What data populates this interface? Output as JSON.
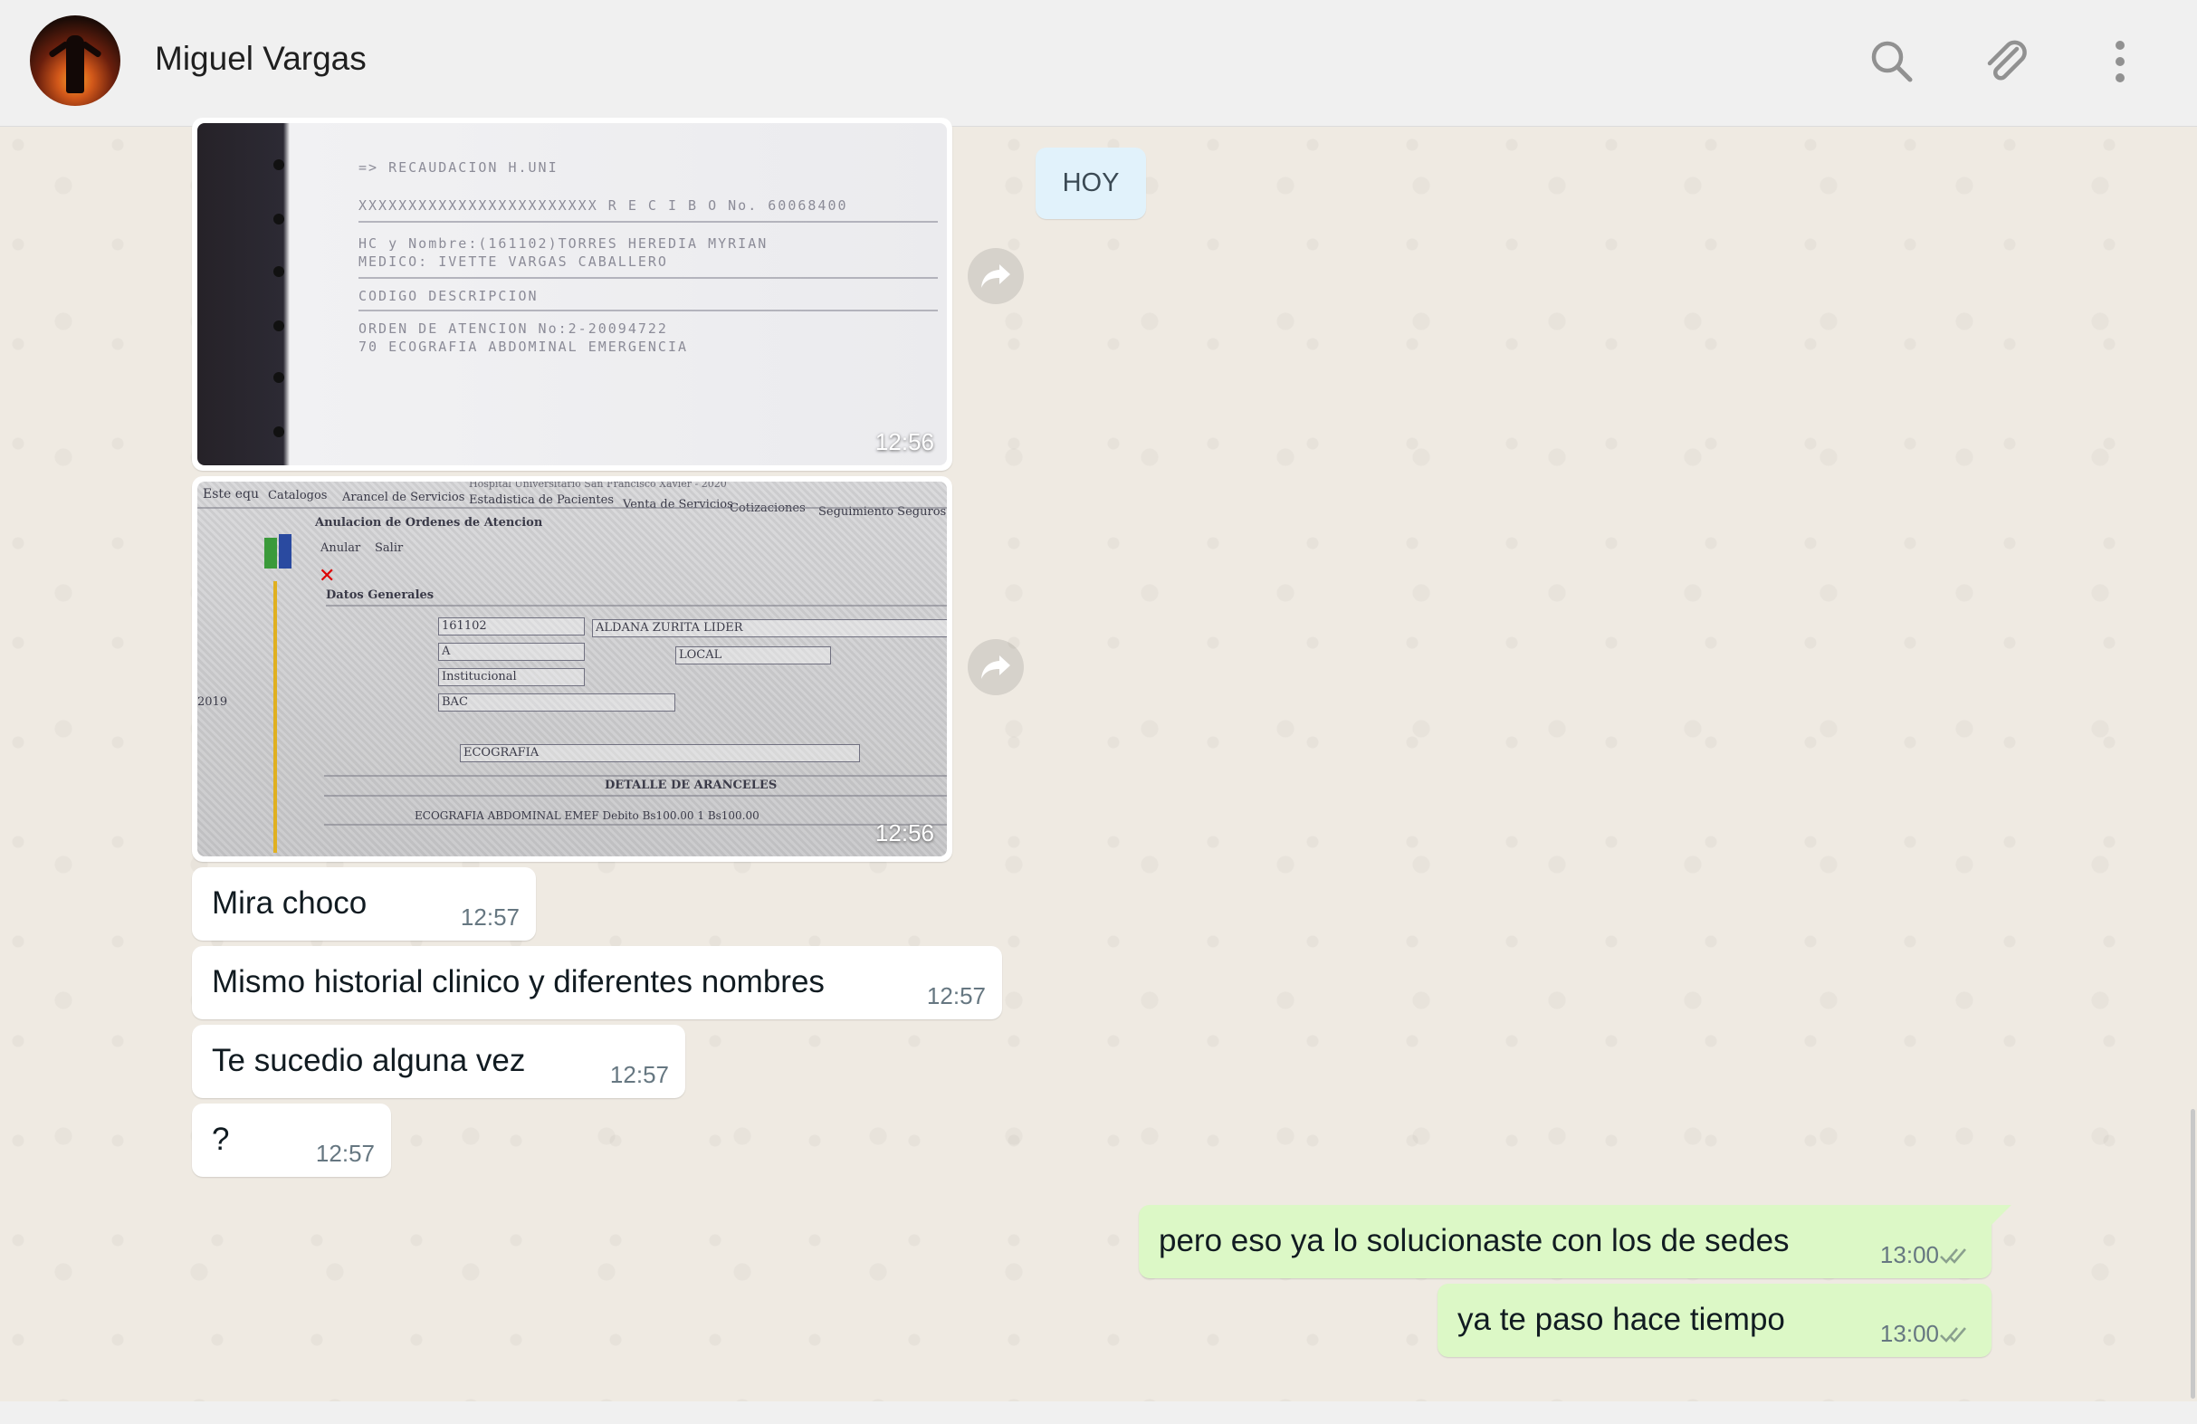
{
  "header": {
    "contact_name": "Miguel Vargas",
    "icons": [
      "search-icon",
      "attach-icon",
      "menu-icon"
    ]
  },
  "date_chip": "HOY",
  "images": [
    {
      "time": "12:56",
      "lines": [
        "=> RECAUDACION H.UNI",
        "XXXXXXXXXXXXXXXXXXXXXXXX   R E C I B O   No. 60068400",
        "HC y Nombre:(161102)TORRES HEREDIA MYRIAN",
        "MEDICO: IVETTE VARGAS CABALLERO",
        "CODIGO  DESCRIPCION",
        "ORDEN DE ATENCION No:2-20094722",
        "70 ECOGRAFIA ABDOMINAL EMERGENCIA"
      ]
    },
    {
      "time": "12:56",
      "labels": {
        "menu": [
          "Este equ",
          "Catalogos",
          "Arancel de Servicios",
          "Estadistica de Pacientes",
          "Venta de Servicios",
          "Cotizaciones",
          "Seguimiento Seguros"
        ],
        "window_title": "Anulacion de Ordenes de Atencion",
        "toolbar": [
          "Anular",
          "Salir"
        ],
        "section": "Datos Generales",
        "hc": "161102",
        "name": "ALDANA ZURITA LIDER",
        "categoria": "A",
        "tipo": "Institucional",
        "dpto": "BAC",
        "procedencia": "LOCAL",
        "servicio": "ECOGRAFIA",
        "detail_title": "DETALLE DE ARANCELES",
        "detail_row": "ECOGRAFIA ABDOMINAL EMEF  Debito      Bs100.00      1      Bs100.00",
        "year": "2019",
        "top": "Hospital Universitario San Francisco Xavier - 2020"
      }
    }
  ],
  "messages": [
    {
      "text": "Mira choco",
      "time": "12:57"
    },
    {
      "text": "Mismo historial clinico y diferentes nombres",
      "time": "12:57"
    },
    {
      "text": "Te sucedio alguna vez",
      "time": "12:57"
    },
    {
      "text": "?",
      "time": "12:57"
    },
    {
      "text": "pero eso ya lo solucionaste con los de sedes",
      "time": "13:00"
    },
    {
      "text": "ya te paso hace tiempo",
      "time": "13:00"
    }
  ],
  "colors": {
    "chat_background": "#efeae2",
    "outgoing_bubble": "#dcf8c6",
    "incoming_bubble": "#ffffff",
    "date_chip": "#e1f2fb",
    "header": "#f0f0f0"
  }
}
